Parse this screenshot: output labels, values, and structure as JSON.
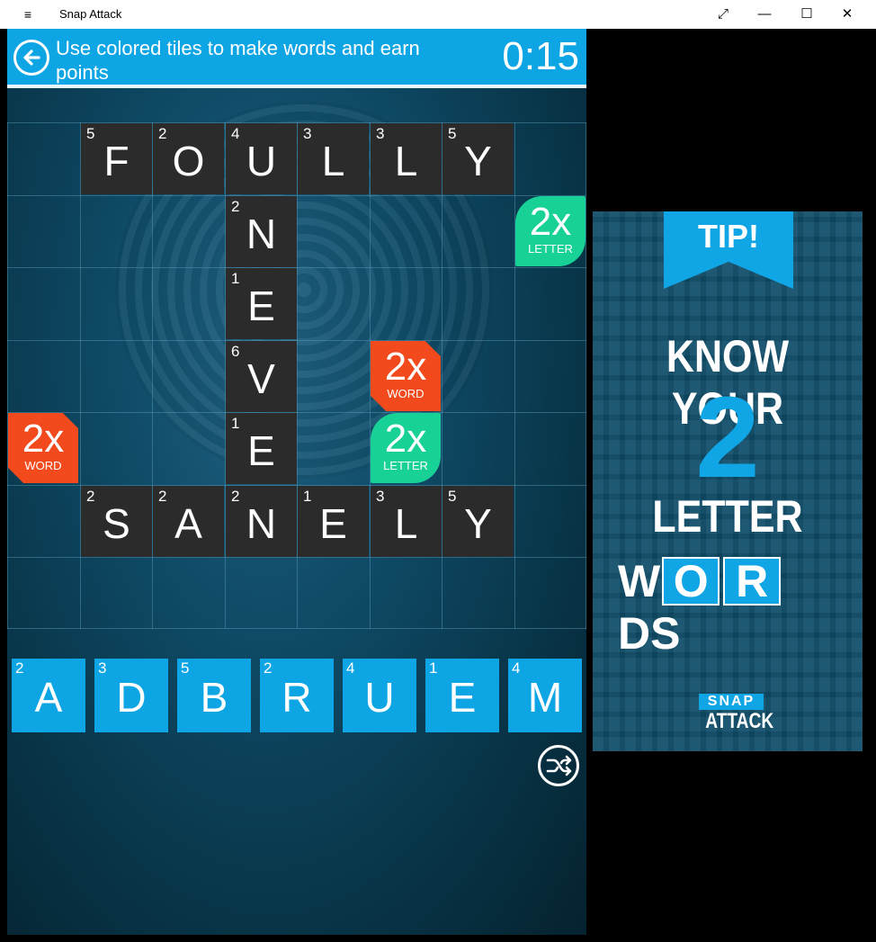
{
  "window": {
    "title": "Snap Attack",
    "menu_glyph": "≡",
    "controls": {
      "restore": "⤢",
      "minimize": "—",
      "maximize": "☐",
      "close": "✕"
    }
  },
  "header": {
    "instruction": "Use colored tiles to make words and earn points",
    "timer": "0:15"
  },
  "board": {
    "rows": 7,
    "cols": 8,
    "tiles": [
      {
        "row": 0,
        "col": 1,
        "letter": "F",
        "points": "5"
      },
      {
        "row": 0,
        "col": 2,
        "letter": "O",
        "points": "2"
      },
      {
        "row": 0,
        "col": 3,
        "letter": "U",
        "points": "4"
      },
      {
        "row": 0,
        "col": 4,
        "letter": "L",
        "points": "3"
      },
      {
        "row": 0,
        "col": 5,
        "letter": "L",
        "points": "3"
      },
      {
        "row": 0,
        "col": 6,
        "letter": "Y",
        "points": "5"
      },
      {
        "row": 1,
        "col": 3,
        "letter": "N",
        "points": "2"
      },
      {
        "row": 2,
        "col": 3,
        "letter": "E",
        "points": "1"
      },
      {
        "row": 3,
        "col": 3,
        "letter": "V",
        "points": "6"
      },
      {
        "row": 4,
        "col": 3,
        "letter": "E",
        "points": "1"
      },
      {
        "row": 5,
        "col": 1,
        "letter": "S",
        "points": "2"
      },
      {
        "row": 5,
        "col": 2,
        "letter": "A",
        "points": "2"
      },
      {
        "row": 5,
        "col": 3,
        "letter": "N",
        "points": "2"
      },
      {
        "row": 5,
        "col": 4,
        "letter": "E",
        "points": "1"
      },
      {
        "row": 5,
        "col": 5,
        "letter": "L",
        "points": "3"
      },
      {
        "row": 5,
        "col": 6,
        "letter": "Y",
        "points": "5"
      }
    ],
    "bonuses": [
      {
        "row": 1,
        "col": 7,
        "mult": "2x",
        "kind": "LETTER",
        "type": "letter"
      },
      {
        "row": 3,
        "col": 5,
        "mult": "2x",
        "kind": "WORD",
        "type": "word"
      },
      {
        "row": 4,
        "col": 0,
        "mult": "2x",
        "kind": "WORD",
        "type": "word"
      },
      {
        "row": 4,
        "col": 5,
        "mult": "2x",
        "kind": "LETTER",
        "type": "letter"
      }
    ]
  },
  "rack": [
    {
      "letter": "A",
      "points": "2"
    },
    {
      "letter": "D",
      "points": "3"
    },
    {
      "letter": "B",
      "points": "5"
    },
    {
      "letter": "R",
      "points": "2"
    },
    {
      "letter": "U",
      "points": "4"
    },
    {
      "letter": "E",
      "points": "1"
    },
    {
      "letter": "M",
      "points": "4"
    }
  ],
  "shuffle_icon": "shuffle-icon",
  "ad": {
    "ribbon": "TIP!",
    "line1": "KNOW YOUR",
    "number": "2",
    "line3": "LETTER",
    "line4_parts": [
      "W",
      "O",
      "R",
      "DS"
    ],
    "logo_top": "SNAP",
    "logo_bottom": "ATTACK"
  },
  "colors": {
    "header_blue": "#0ea5e5",
    "tile_dark": "#2b2b2b",
    "word_bonus": "#f24a1d",
    "letter_bonus": "#18d196"
  }
}
